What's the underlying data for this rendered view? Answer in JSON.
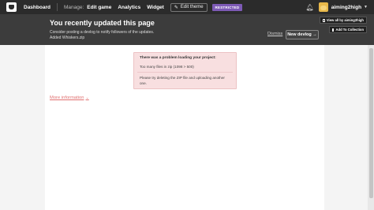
{
  "topbar": {
    "dashboard": "Dashboard",
    "manage_label": "Manage:",
    "nav": [
      "Edit game",
      "Analytics",
      "Widget"
    ],
    "edit_theme": "Edit theme",
    "restricted": "RESTRICTED",
    "username": "aiming2high",
    "icons": {
      "logo": "itch-logo-icon",
      "bell": "bell-icon",
      "caret": "chevron-down-icon",
      "pen": "pencil-icon"
    }
  },
  "banner": {
    "title": "You recently updated this page",
    "line1": "Consider posting a devlog to notify followers of the updates.",
    "line2": "Added Whiskers.zip",
    "dismiss": "Dismiss",
    "new_devlog": "New devlog →"
  },
  "side_buttons": {
    "view_all": "View all by aiming2high",
    "add_collection": "Add To Collection"
  },
  "error": {
    "title": "There was a problem loading your project:",
    "detail": "Too many files in zip (1098 > 500)",
    "hint": "Please try deleting the ZIP file and uploading another one."
  },
  "more_info": "More information",
  "colors": {
    "topbar": "#2b2b2b",
    "banner": "#3c3c3c",
    "restricted": "#7d5ab5",
    "error_bg": "#f8dfe0",
    "link": "#e07070"
  }
}
